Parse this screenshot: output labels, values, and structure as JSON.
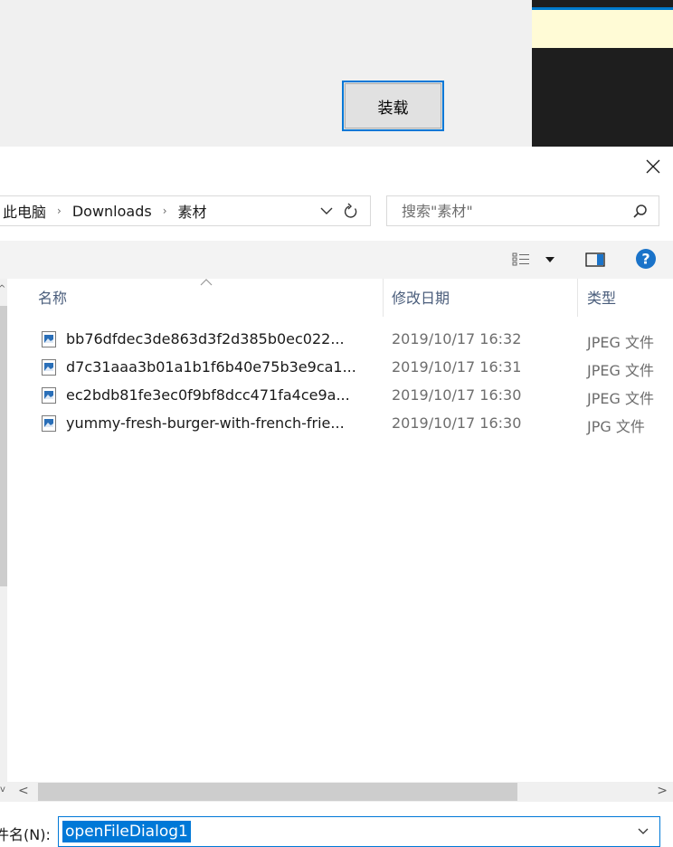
{
  "background_form": {
    "load_button_label": "装载"
  },
  "dialog": {
    "breadcrumb": [
      "此电脑",
      "Downloads",
      "素材"
    ],
    "search_placeholder": "搜索\"素材\"",
    "columns": {
      "name": "名称",
      "date": "修改日期",
      "type": "类型"
    },
    "files": [
      {
        "name": "bb76dfdec3de863d3f2d385b0ec022...",
        "date": "2019/10/17 16:32",
        "type": "JPEG 文件",
        "icon": "image-file-icon"
      },
      {
        "name": "d7c31aaa3b01a1b1f6b40e75b3e9ca1...",
        "date": "2019/10/17 16:31",
        "type": "JPEG 文件",
        "icon": "image-file-icon"
      },
      {
        "name": "ec2bdb81fe3ec0f9bf8dcc471fa4ce9a...",
        "date": "2019/10/17 16:30",
        "type": "JPEG 文件",
        "icon": "image-file-icon"
      },
      {
        "name": "yummy-fresh-burger-with-french-frie...",
        "date": "2019/10/17 16:30",
        "type": "JPG 文件",
        "icon": "image-file-icon"
      }
    ],
    "filename_label": "件名(N):",
    "filename_value": "openFileDialog1"
  },
  "colors": {
    "accent": "#0078d7",
    "editor_bg": "#1e1e1e",
    "editor_highlight": "#fffbd6",
    "help_blue": "#1a73c9"
  }
}
